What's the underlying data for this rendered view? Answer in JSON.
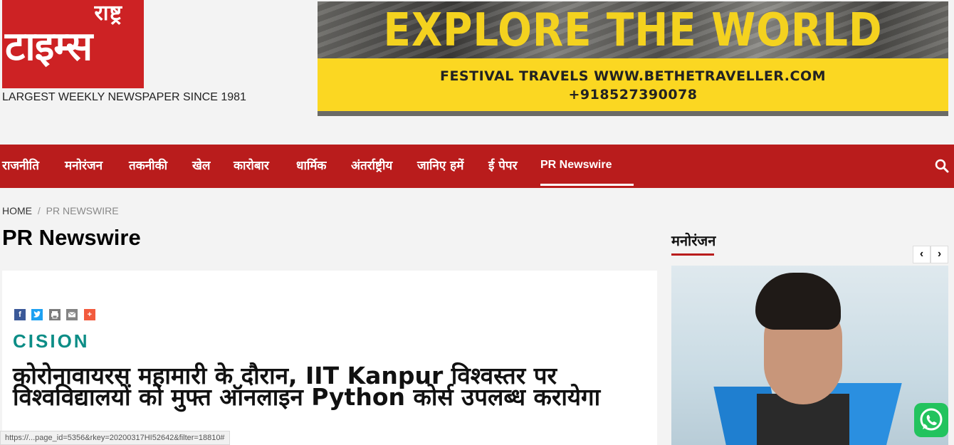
{
  "header": {
    "logo_top": "राष्ट्र",
    "logo_main": "टाइम्स",
    "tagline": "LARGEST WEEKLY NEWSPAPER SINCE 1981"
  },
  "banner": {
    "headline": "EXPLORE THE WORLD",
    "line1": "FESTIVAL TRAVELS WWW.BETHETRAVELLER.COM",
    "line2": "+918527390078"
  },
  "nav": {
    "items": [
      "राजनीति",
      "मनोरंजन",
      "तकनीकी",
      "खेल",
      "कारोबार",
      "धार्मिक",
      "अंतर्राष्ट्रीय",
      "जानिए हमें",
      "ई पेपर",
      "PR Newswire"
    ],
    "active": "PR Newswire"
  },
  "breadcrumb": {
    "home": "HOME",
    "separator": "/",
    "current": "PR NEWSWIRE"
  },
  "page": {
    "title": "PR Newswire"
  },
  "article": {
    "share_icons": [
      "facebook-icon",
      "twitter-icon",
      "print-icon",
      "email-icon",
      "plus-icon"
    ],
    "brand": "CISION",
    "headline": "कोरोनावायरस महामारी के दौरान, IIT Kanpur विश्वस्तर पर विश्वविद्यालयों को मुफ्त ऑनलाइन Python कोर्स उपलब्ध करायेगा"
  },
  "status_bar": {
    "url": "https://...page_id=5356&rkey=20200317HI52642&filter=18810#"
  },
  "sidebar": {
    "section_title": "मनोरंजन",
    "prev_label": "‹",
    "next_label": "›"
  },
  "colors": {
    "brand_red": "#b91c1c",
    "logo_red": "#cd2224",
    "banner_yellow": "#fbd722",
    "cision_teal": "#0c8d86",
    "whatsapp_green": "#22c35e"
  }
}
